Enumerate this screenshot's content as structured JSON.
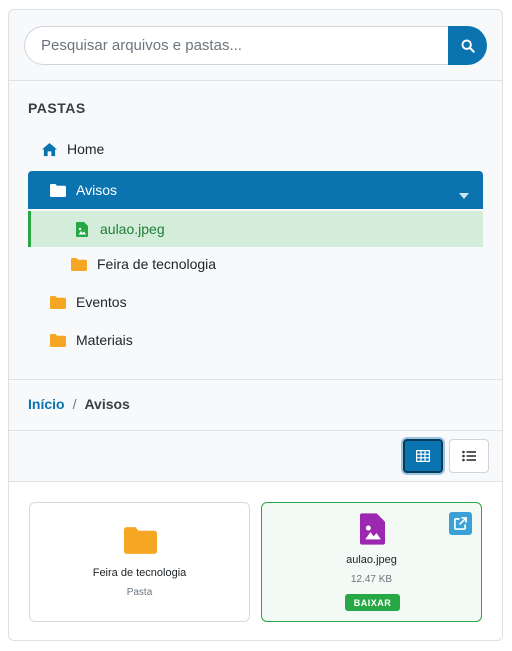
{
  "search": {
    "placeholder": "Pesquisar arquivos e pastas..."
  },
  "sidebar": {
    "title": "PASTAS",
    "items": [
      {
        "label": "Home",
        "icon": "home-icon"
      },
      {
        "label": "Avisos",
        "icon": "folder-open-icon",
        "state": "expanded-active"
      },
      {
        "label": "aulao.jpeg",
        "icon": "image-file-icon",
        "state": "selected"
      },
      {
        "label": "Feira de tecnologia",
        "icon": "folder-icon"
      },
      {
        "label": "Eventos",
        "icon": "folder-icon"
      },
      {
        "label": "Materiais",
        "icon": "folder-icon"
      }
    ]
  },
  "breadcrumb": {
    "root": "Início",
    "separator": "/",
    "current": "Avisos"
  },
  "view_toggle": {
    "active": "grid",
    "options": [
      "grid",
      "list"
    ]
  },
  "cards": [
    {
      "name": "Feira de tecnologia",
      "meta": "Pasta",
      "icon": "folder-icon"
    },
    {
      "name": "aulao.jpeg",
      "meta": "12.47 KB",
      "icon": "image-file-icon",
      "action": "BAIXAR"
    }
  ],
  "colors": {
    "primary": "#0b74b0",
    "success": "#28a745",
    "folder": "#f5a623",
    "image_file": "#9c27b0",
    "selected_bg": "#d4edda"
  }
}
